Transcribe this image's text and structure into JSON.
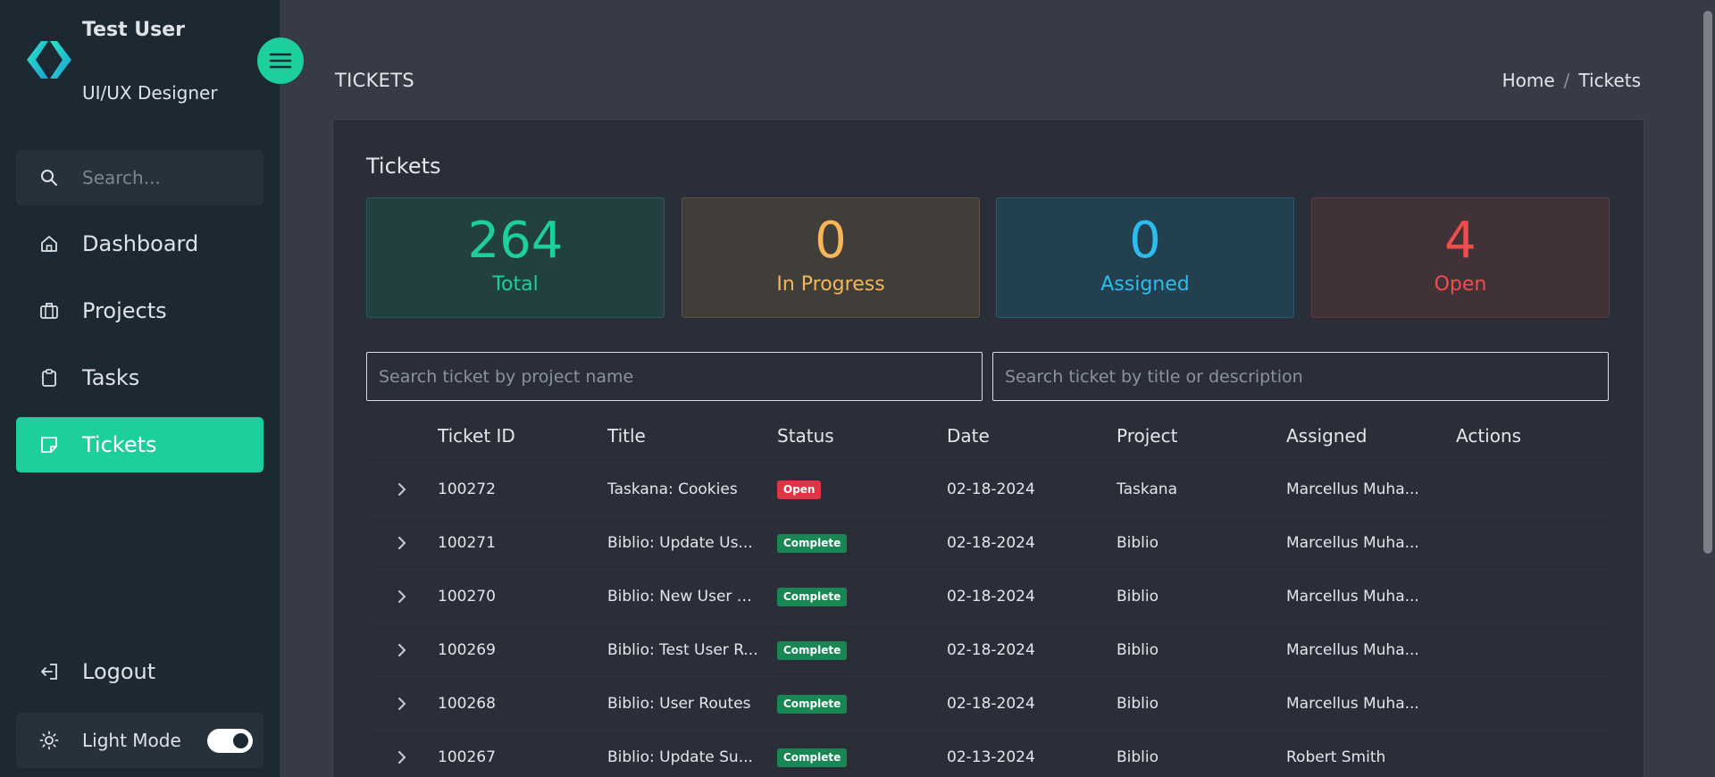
{
  "user": {
    "name": "Test User",
    "role": "UI/UX Designer"
  },
  "sidebar": {
    "search_placeholder": "Search...",
    "items": [
      {
        "label": "Dashboard",
        "icon": "home-icon"
      },
      {
        "label": "Projects",
        "icon": "briefcase-icon"
      },
      {
        "label": "Tasks",
        "icon": "clipboard-icon"
      },
      {
        "label": "Tickets",
        "icon": "note-icon",
        "active": true
      }
    ],
    "logout_label": "Logout",
    "mode_label": "Light Mode"
  },
  "header": {
    "page_title": "TICKETS",
    "breadcrumb": [
      "Home",
      "Tickets"
    ],
    "breadcrumb_separator": "/"
  },
  "card": {
    "title": "Tickets",
    "stats": [
      {
        "value": "264",
        "label": "Total",
        "color": "#1ccf9c"
      },
      {
        "value": "0",
        "label": "In Progress",
        "color": "#f5b559"
      },
      {
        "value": "0",
        "label": "Assigned",
        "color": "#2ebcee"
      },
      {
        "value": "4",
        "label": "Open",
        "color": "#f04d4d"
      }
    ],
    "filter_project_placeholder": "Search ticket by project name",
    "filter_title_placeholder": "Search ticket by title or description"
  },
  "table": {
    "columns": [
      "Ticket ID",
      "Title",
      "Status",
      "Date",
      "Project",
      "Assigned",
      "Actions"
    ],
    "rows": [
      {
        "id": "100272",
        "title": "Taskana: Cookies",
        "status": "Open",
        "status_color": "#dc3545",
        "date": "02-18-2024",
        "project": "Taskana",
        "assigned": "Marcellus Muha..."
      },
      {
        "id": "100271",
        "title": "Biblio: Update Us...",
        "status": "Complete",
        "status_color": "#198754",
        "date": "02-18-2024",
        "project": "Biblio",
        "assigned": "Marcellus Muha..."
      },
      {
        "id": "100270",
        "title": "Biblio: New User S...",
        "status": "Complete",
        "status_color": "#198754",
        "date": "02-18-2024",
        "project": "Biblio",
        "assigned": "Marcellus Muha..."
      },
      {
        "id": "100269",
        "title": "Biblio: Test User R...",
        "status": "Complete",
        "status_color": "#198754",
        "date": "02-18-2024",
        "project": "Biblio",
        "assigned": "Marcellus Muha..."
      },
      {
        "id": "100268",
        "title": "Biblio: User Routes",
        "status": "Complete",
        "status_color": "#198754",
        "date": "02-18-2024",
        "project": "Biblio",
        "assigned": "Marcellus Muha..."
      },
      {
        "id": "100267",
        "title": "Biblio: Update Su...",
        "status": "Complete",
        "status_color": "#198754",
        "date": "02-13-2024",
        "project": "Biblio",
        "assigned": "Robert Smith"
      }
    ]
  },
  "colors": {
    "accent": "#1ccf9c",
    "sidebar_bg": "#1c2832",
    "main_bg": "#373b46",
    "card_bg": "#2a2e38"
  }
}
